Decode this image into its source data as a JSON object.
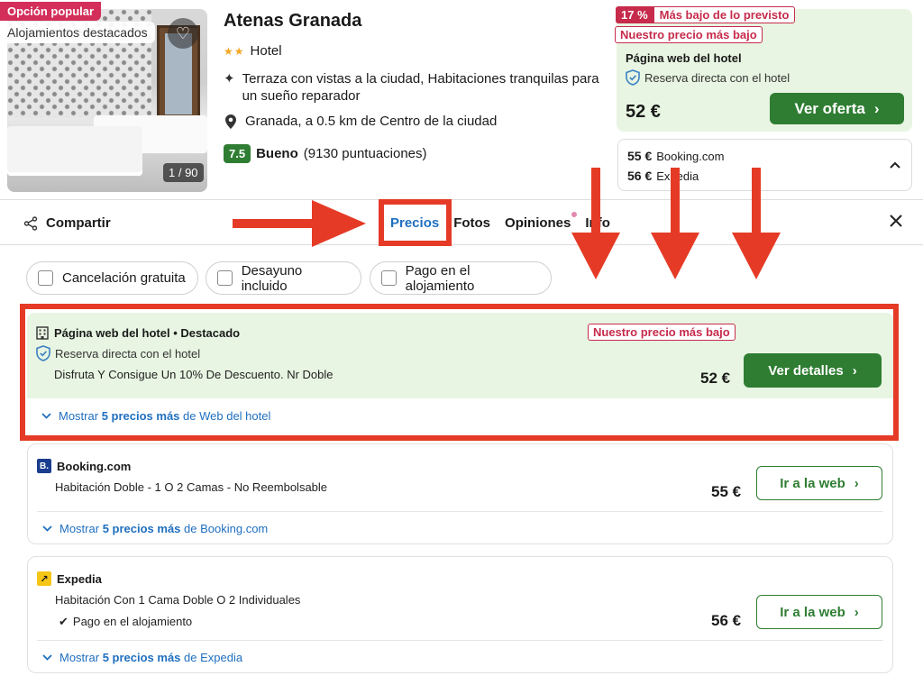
{
  "hotel": {
    "badge_popular": "Opción popular",
    "badge_featured": "Alojamientos destacados",
    "photo_count": "1 / 90",
    "name": "Atenas Granada",
    "stars": "★★",
    "type": "Hotel",
    "feature": "Terraza con vistas a la ciudad, Habitaciones tranquilas para un sueño reparador",
    "location": "Granada, a 0.5 km de Centro de la ciudad",
    "rating_score": "7.5",
    "rating_label": "Bueno",
    "rating_count": "(9130 puntuaciones)"
  },
  "offer_box": {
    "pct": "17 %",
    "pct_text": "Más bajo de lo previsto",
    "lowest": "Nuestro precio más bajo",
    "provider": "Página web del hotel",
    "direct": "Reserva directa con el hotel",
    "price": "52 €",
    "button": "Ver oferta"
  },
  "alt_prices": [
    {
      "price": "55 €",
      "provider": "Booking.com"
    },
    {
      "price": "56 €",
      "provider": "Expedia"
    }
  ],
  "tabbar": {
    "share": "Compartir",
    "tabs": [
      "Precios",
      "Fotos",
      "Opiniones",
      "Info"
    ]
  },
  "filters": [
    "Cancelación gratuita",
    "Desayuno incluido",
    "Pago en el alojamiento"
  ],
  "offers": [
    {
      "provider": "Página web del hotel • Destacado",
      "lowest": "Nuestro precio más bajo",
      "direct": "Reserva directa con el hotel",
      "description": "Disfruta Y Consigue Un 10% De Descuento. Nr Doble",
      "price": "52 €",
      "button": "Ver detalles",
      "more_prefix": "Mostrar",
      "more_count": "5 precios más",
      "more_suffix": "de Web del hotel"
    },
    {
      "provider": "Booking.com",
      "description": "Habitación Doble - 1 O 2 Camas - No Reembolsable",
      "price": "55 €",
      "button": "Ir a la web",
      "more_prefix": "Mostrar",
      "more_count": "5 precios más",
      "more_suffix": "de Booking.com"
    },
    {
      "provider": "Expedia",
      "description": "Habitación Con 1 Cama Doble O 2 Individuales",
      "extra": "Pago en el alojamiento",
      "price": "56 €",
      "button": "Ir a la web",
      "more_prefix": "Mostrar",
      "more_count": "5 precios más",
      "more_suffix": "de Expedia"
    }
  ],
  "colors": {
    "accent_blue": "#1f6fbf",
    "green": "#2f7d32",
    "light_green": "#e8f5e2",
    "badge_red": "#c62b4b",
    "annotation_red": "#e53b26"
  }
}
